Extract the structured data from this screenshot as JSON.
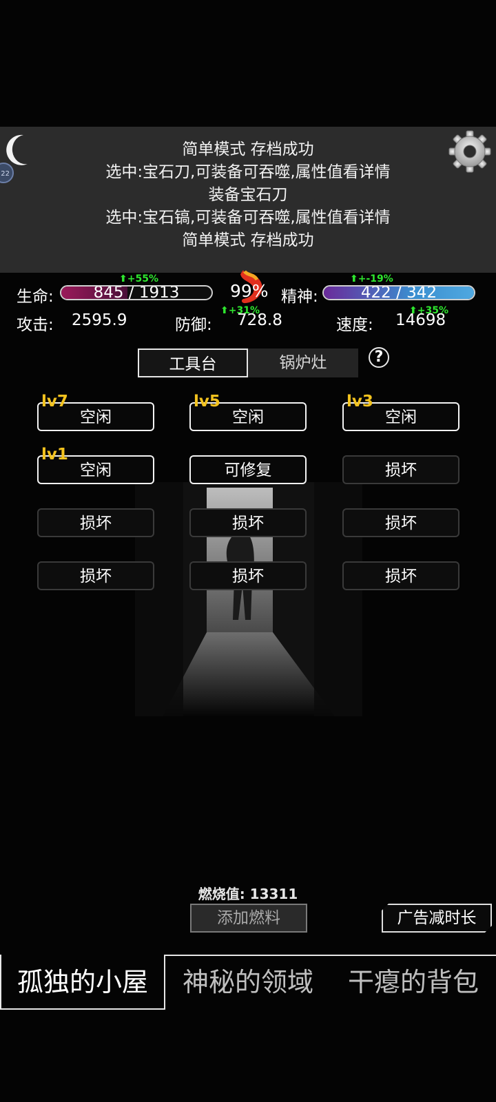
{
  "log": {
    "lines": [
      "简单模式 存档成功",
      "选中:宝石刀,可装备可吞噬,属性值看详情",
      "装备宝石刀",
      "选中:宝石镐,可装备可吞噬,属性值看详情",
      "简单模式 存档成功"
    ]
  },
  "badge_text": "22",
  "stats": {
    "hp_label": "生命:",
    "hp_value": "845 / 1913",
    "hp_fill": 0.44,
    "hp_delta": "+55%",
    "stomach_percent": "99%",
    "spirit_label": "精神:",
    "spirit_value": "422 / 342",
    "spirit_fill": 1.0,
    "spirit_delta": "+-19%",
    "attack_label": "攻击:",
    "attack_value": "2595.9",
    "defense_label": "防御:",
    "defense_value": "728.8",
    "defense_delta": "+31%",
    "speed_label": "速度:",
    "speed_value": "14698",
    "speed_delta": "+35%"
  },
  "tabs": {
    "workbench": "工具台",
    "furnace": "锅炉灶",
    "help": "?"
  },
  "slots": [
    {
      "label": "空闲",
      "level": "lv7",
      "state": "active"
    },
    {
      "label": "空闲",
      "level": "lv5",
      "state": "active"
    },
    {
      "label": "空闲",
      "level": "lv3",
      "state": "active"
    },
    {
      "label": "空闲",
      "level": "lv1",
      "state": "active"
    },
    {
      "label": "可修复",
      "level": "",
      "state": "active"
    },
    {
      "label": "损坏",
      "level": "",
      "state": "broken"
    },
    {
      "label": "损坏",
      "level": "",
      "state": "broken"
    },
    {
      "label": "损坏",
      "level": "",
      "state": "broken"
    },
    {
      "label": "损坏",
      "level": "",
      "state": "broken"
    },
    {
      "label": "损坏",
      "level": "",
      "state": "broken"
    },
    {
      "label": "损坏",
      "level": "",
      "state": "broken"
    },
    {
      "label": "损坏",
      "level": "",
      "state": "broken"
    }
  ],
  "fuel": {
    "label": "燃烧值: 13311",
    "add_button": "添加燃料",
    "ad_button": "广告减时长"
  },
  "bottom_tabs": {
    "house": "孤独的小屋",
    "domain": "神秘的领域",
    "backpack": "干瘪的背包"
  },
  "colors": {
    "hp_fill": "#6a1a4a",
    "spirit_fill": "#3a8fd0",
    "level_text": "#f2c21e",
    "delta_green": "#2ee62e"
  }
}
